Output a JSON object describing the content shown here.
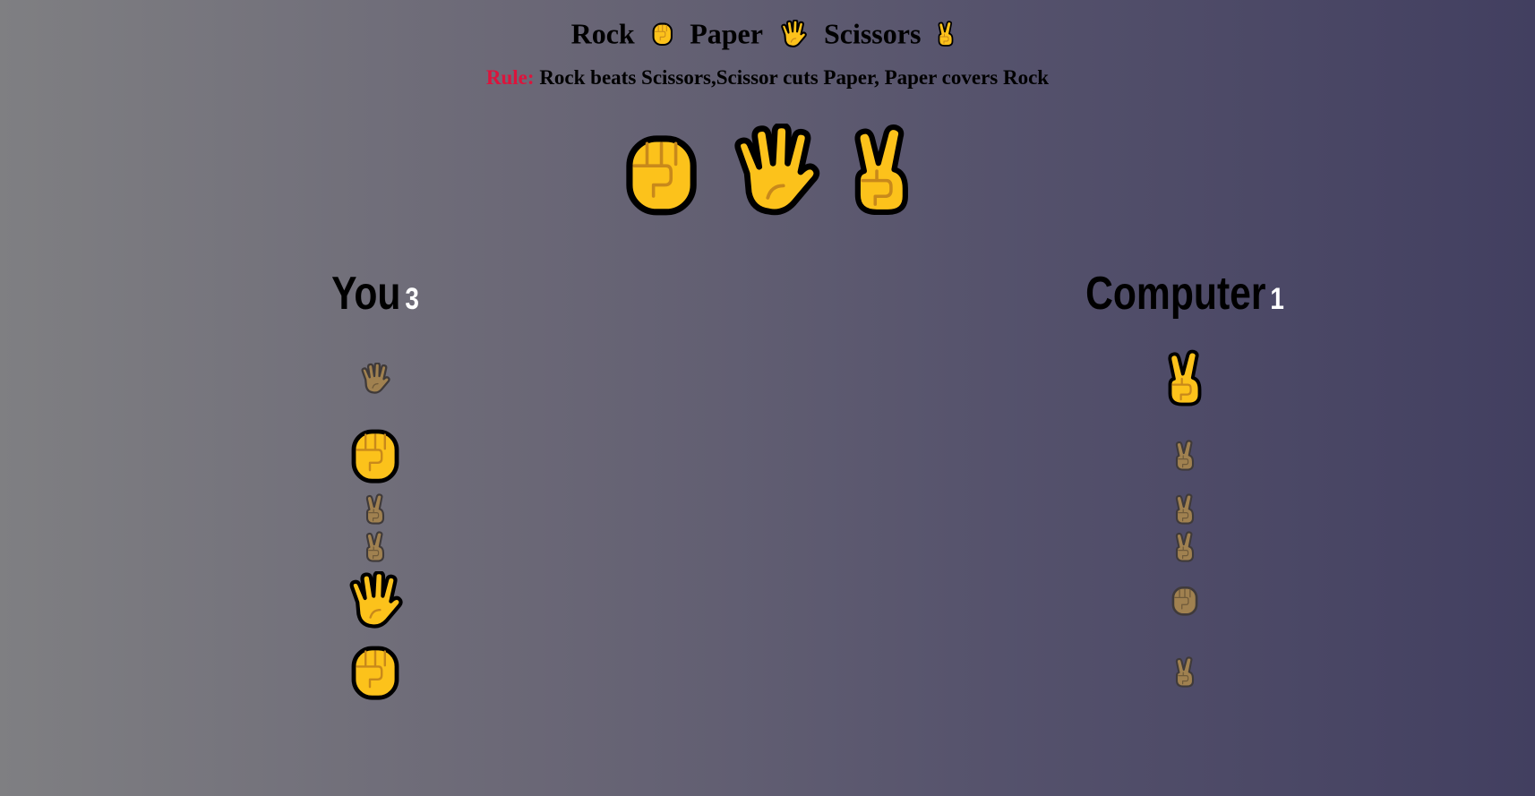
{
  "header": {
    "title_words": [
      "Rock",
      "Paper",
      "Scissors"
    ],
    "title_icons": [
      "rock-icon",
      "paper-icon",
      "scissors-icon"
    ],
    "rule_label": "Rule:",
    "rule_text": " Rock beats Scissors,Scissor cuts Paper, Paper covers Rock"
  },
  "choices": [
    {
      "move": "rock",
      "icon": "rock-icon"
    },
    {
      "move": "paper",
      "icon": "paper-icon"
    },
    {
      "move": "scissors",
      "icon": "scissors-icon"
    }
  ],
  "player": {
    "name": "You",
    "score": "3",
    "history": [
      {
        "move": "paper",
        "result": "lose"
      },
      {
        "move": "rock",
        "result": "win"
      },
      {
        "move": "scissors",
        "result": "draw"
      },
      {
        "move": "scissors",
        "result": "draw"
      },
      {
        "move": "paper",
        "result": "win"
      },
      {
        "move": "rock",
        "result": "win"
      }
    ]
  },
  "computer": {
    "name": "Computer",
    "score": "1",
    "history": [
      {
        "move": "scissors",
        "result": "win"
      },
      {
        "move": "scissors",
        "result": "lose"
      },
      {
        "move": "scissors",
        "result": "draw"
      },
      {
        "move": "scissors",
        "result": "draw"
      },
      {
        "move": "rock",
        "result": "lose"
      },
      {
        "move": "scissors",
        "result": "lose"
      }
    ]
  },
  "colors": {
    "emoji_fill": "#fcc21b",
    "emoji_outline": "#000000",
    "emoji_crease": "#c8891b",
    "muted_fill": "#a08150",
    "muted_outline": "#3f3a3a",
    "muted_crease": "#6f5a3a",
    "rule_label": "#dc143c",
    "score_text": "#ffffff"
  }
}
